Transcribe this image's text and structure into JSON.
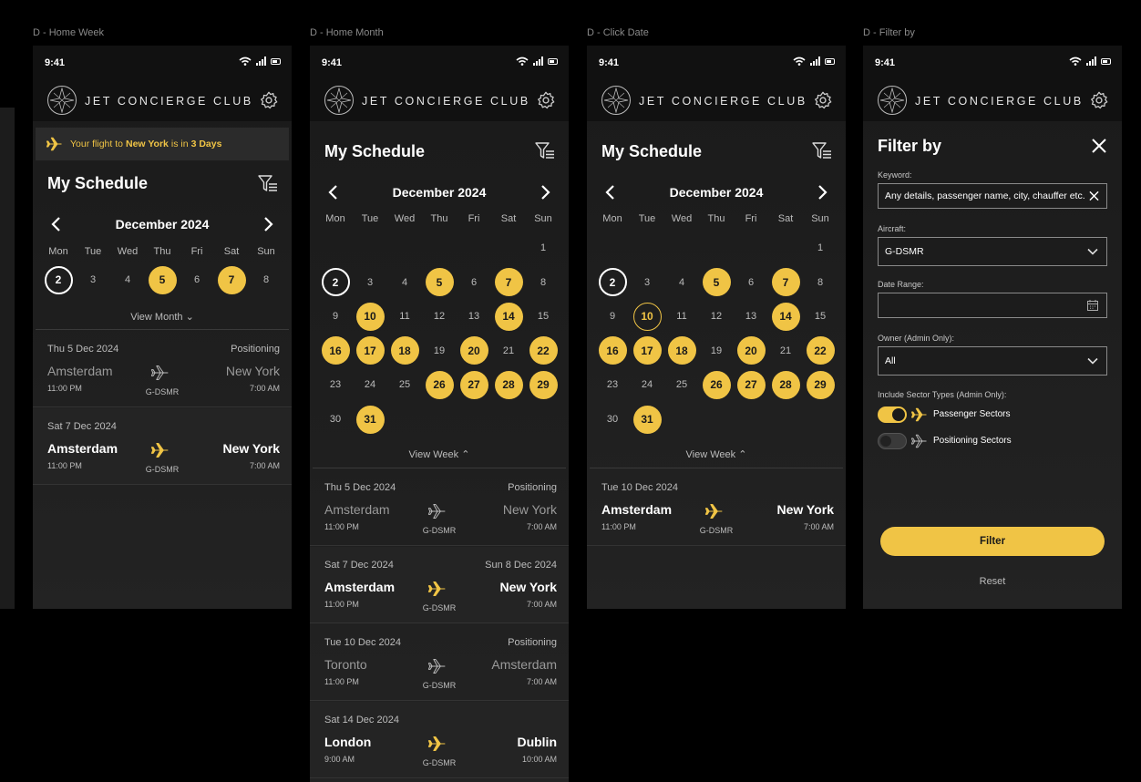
{
  "frames": [
    "D - Home Week",
    "D - Home Month",
    "D - Click Date",
    "D - Filter by"
  ],
  "status_time": "9:41",
  "brand": "JET CONCIERGE CLUB",
  "banner": {
    "pre": "Your flight to",
    "city": "New York",
    "mid": "is in",
    "days": "3 Days"
  },
  "schedule_title": "My Schedule",
  "calendar": {
    "month": "December 2024",
    "weekdays": [
      "Mon",
      "Tue",
      "Wed",
      "Thu",
      "Fri",
      "Sat",
      "Sun"
    ],
    "view_month": "View Month",
    "view_week": "View Week",
    "week_row": [
      "2",
      "3",
      "4",
      "5",
      "6",
      "7",
      "8"
    ],
    "week_flags": [
      "today",
      "",
      "",
      "on",
      "",
      "on",
      ""
    ],
    "month_rows": [
      [
        "",
        "",
        "",
        "",
        "",
        "",
        "1"
      ],
      [
        "2",
        "3",
        "4",
        "5",
        "6",
        "7",
        "8"
      ],
      [
        "9",
        "10",
        "11",
        "12",
        "13",
        "14",
        "15"
      ],
      [
        "16",
        "17",
        "18",
        "19",
        "20",
        "21",
        "22"
      ],
      [
        "23",
        "24",
        "25",
        "26",
        "27",
        "28",
        "29"
      ],
      [
        "30",
        "31",
        "",
        "",
        "",
        "",
        ""
      ]
    ],
    "flight_days": [
      "5",
      "7",
      "10",
      "14",
      "16",
      "17",
      "18",
      "20",
      "22",
      "26",
      "27",
      "28",
      "29",
      "31"
    ],
    "today_day": "2",
    "selected_day": "10"
  },
  "flights_week": [
    {
      "date": "Thu 5 Dec 2024",
      "right": "Positioning",
      "from": "Amsterdam",
      "to": "New York",
      "from_time": "11:00 PM",
      "to_time": "7:00 AM",
      "reg": "G-DSMR",
      "type": "pos"
    },
    {
      "date": "Sat 7 Dec 2024",
      "right": "",
      "from": "Amsterdam",
      "to": "New York",
      "from_time": "11:00 PM",
      "to_time": "7:00 AM",
      "reg": "G-DSMR",
      "type": "pax"
    }
  ],
  "flights_month": [
    {
      "date": "Thu 5 Dec 2024",
      "right": "Positioning",
      "from": "Amsterdam",
      "to": "New York",
      "from_time": "11:00 PM",
      "to_time": "7:00 AM",
      "reg": "G-DSMR",
      "type": "pos"
    },
    {
      "date": "Sat 7 Dec 2024",
      "right": "Sun 8 Dec 2024",
      "from": "Amsterdam",
      "to": "New York",
      "from_time": "11:00 PM",
      "to_time": "7:00 AM",
      "reg": "G-DSMR",
      "type": "pax"
    },
    {
      "date": "Tue 10 Dec 2024",
      "right": "Positioning",
      "from": "Toronto",
      "to": "Amsterdam",
      "from_time": "11:00 PM",
      "to_time": "7:00 AM",
      "reg": "G-DSMR",
      "type": "pos"
    },
    {
      "date": "Sat 14 Dec 2024",
      "right": "",
      "from": "London",
      "to": "Dublin",
      "from_time": "9:00 AM",
      "to_time": "10:00 AM",
      "reg": "G-DSMR",
      "type": "pax"
    }
  ],
  "flights_click": [
    {
      "date": "Tue 10 Dec 2024",
      "right": "",
      "from": "Amsterdam",
      "to": "New York",
      "from_time": "11:00 PM",
      "to_time": "7:00 AM",
      "reg": "G-DSMR",
      "type": "pax"
    }
  ],
  "filter": {
    "title": "Filter by",
    "keyword_label": "Keyword:",
    "keyword_placeholder": "Any details, passenger name, city, chauffer etc.",
    "aircraft_label": "Aircraft:",
    "aircraft_value": "G-DSMR",
    "date_label": "Date Range:",
    "owner_label": "Owner (Admin Only):",
    "owner_value": "All",
    "sector_label": "Include Sector Types (Admin Only):",
    "passenger_label": "Passenger Sectors",
    "positioning_label": "Positioning Sectors",
    "passenger_on": true,
    "positioning_on": false,
    "button": "Filter",
    "reset": "Reset"
  },
  "colors": {
    "accent": "#f0c445",
    "bg": "#1a1a1a",
    "bar": "#111111"
  }
}
